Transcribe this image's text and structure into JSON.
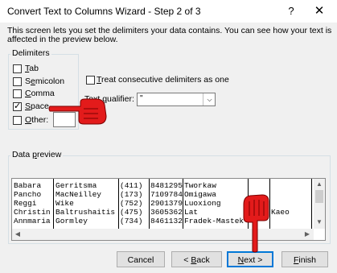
{
  "window": {
    "title": "Convert Text to Columns Wizard - Step 2 of 3",
    "help": "?",
    "close": "✕"
  },
  "description": "This screen lets you set the delimiters your data contains.  You can see how your text is affected in the preview below.",
  "delimiters": {
    "legend": "Delimiters",
    "tab": {
      "label": "Tab",
      "checked": false
    },
    "semicolon": {
      "label": "Semicolon",
      "checked": false
    },
    "comma": {
      "label": "Comma",
      "checked": false
    },
    "space": {
      "label": "Space",
      "checked": true
    },
    "other": {
      "label": "Other:",
      "checked": false,
      "value": ""
    }
  },
  "consecutive": {
    "label": "Treat consecutive delimiters as one",
    "checked": false
  },
  "qualifier": {
    "label": "Text qualifier:",
    "value": "\""
  },
  "preview": {
    "legend": "Data preview",
    "rows": [
      [
        "Babara",
        "Gerritsma",
        "(411)",
        "8481295",
        "Tworkaw",
        "",
        ""
      ],
      [
        "Pancho",
        "MacNeilley",
        "(173)",
        "7109784",
        "Omigawa",
        "",
        ""
      ],
      [
        "Reggi",
        "Wike",
        "(752)",
        "2901379",
        "Luoxiong",
        "",
        ""
      ],
      [
        "Christin",
        "Baltrushaitis",
        "(475)",
        "3605362",
        "Lat",
        "",
        "Kaeo"
      ],
      [
        "Annmaria",
        "Gormley",
        "(734)",
        "8461132",
        "Fradek-Mastek",
        "",
        ""
      ]
    ]
  },
  "buttons": {
    "cancel": "Cancel",
    "back": "< Back",
    "next": "Next >",
    "finish": "Finish"
  },
  "colors": {
    "pointer": "#e31b1b",
    "default_button": "#0078d7"
  }
}
